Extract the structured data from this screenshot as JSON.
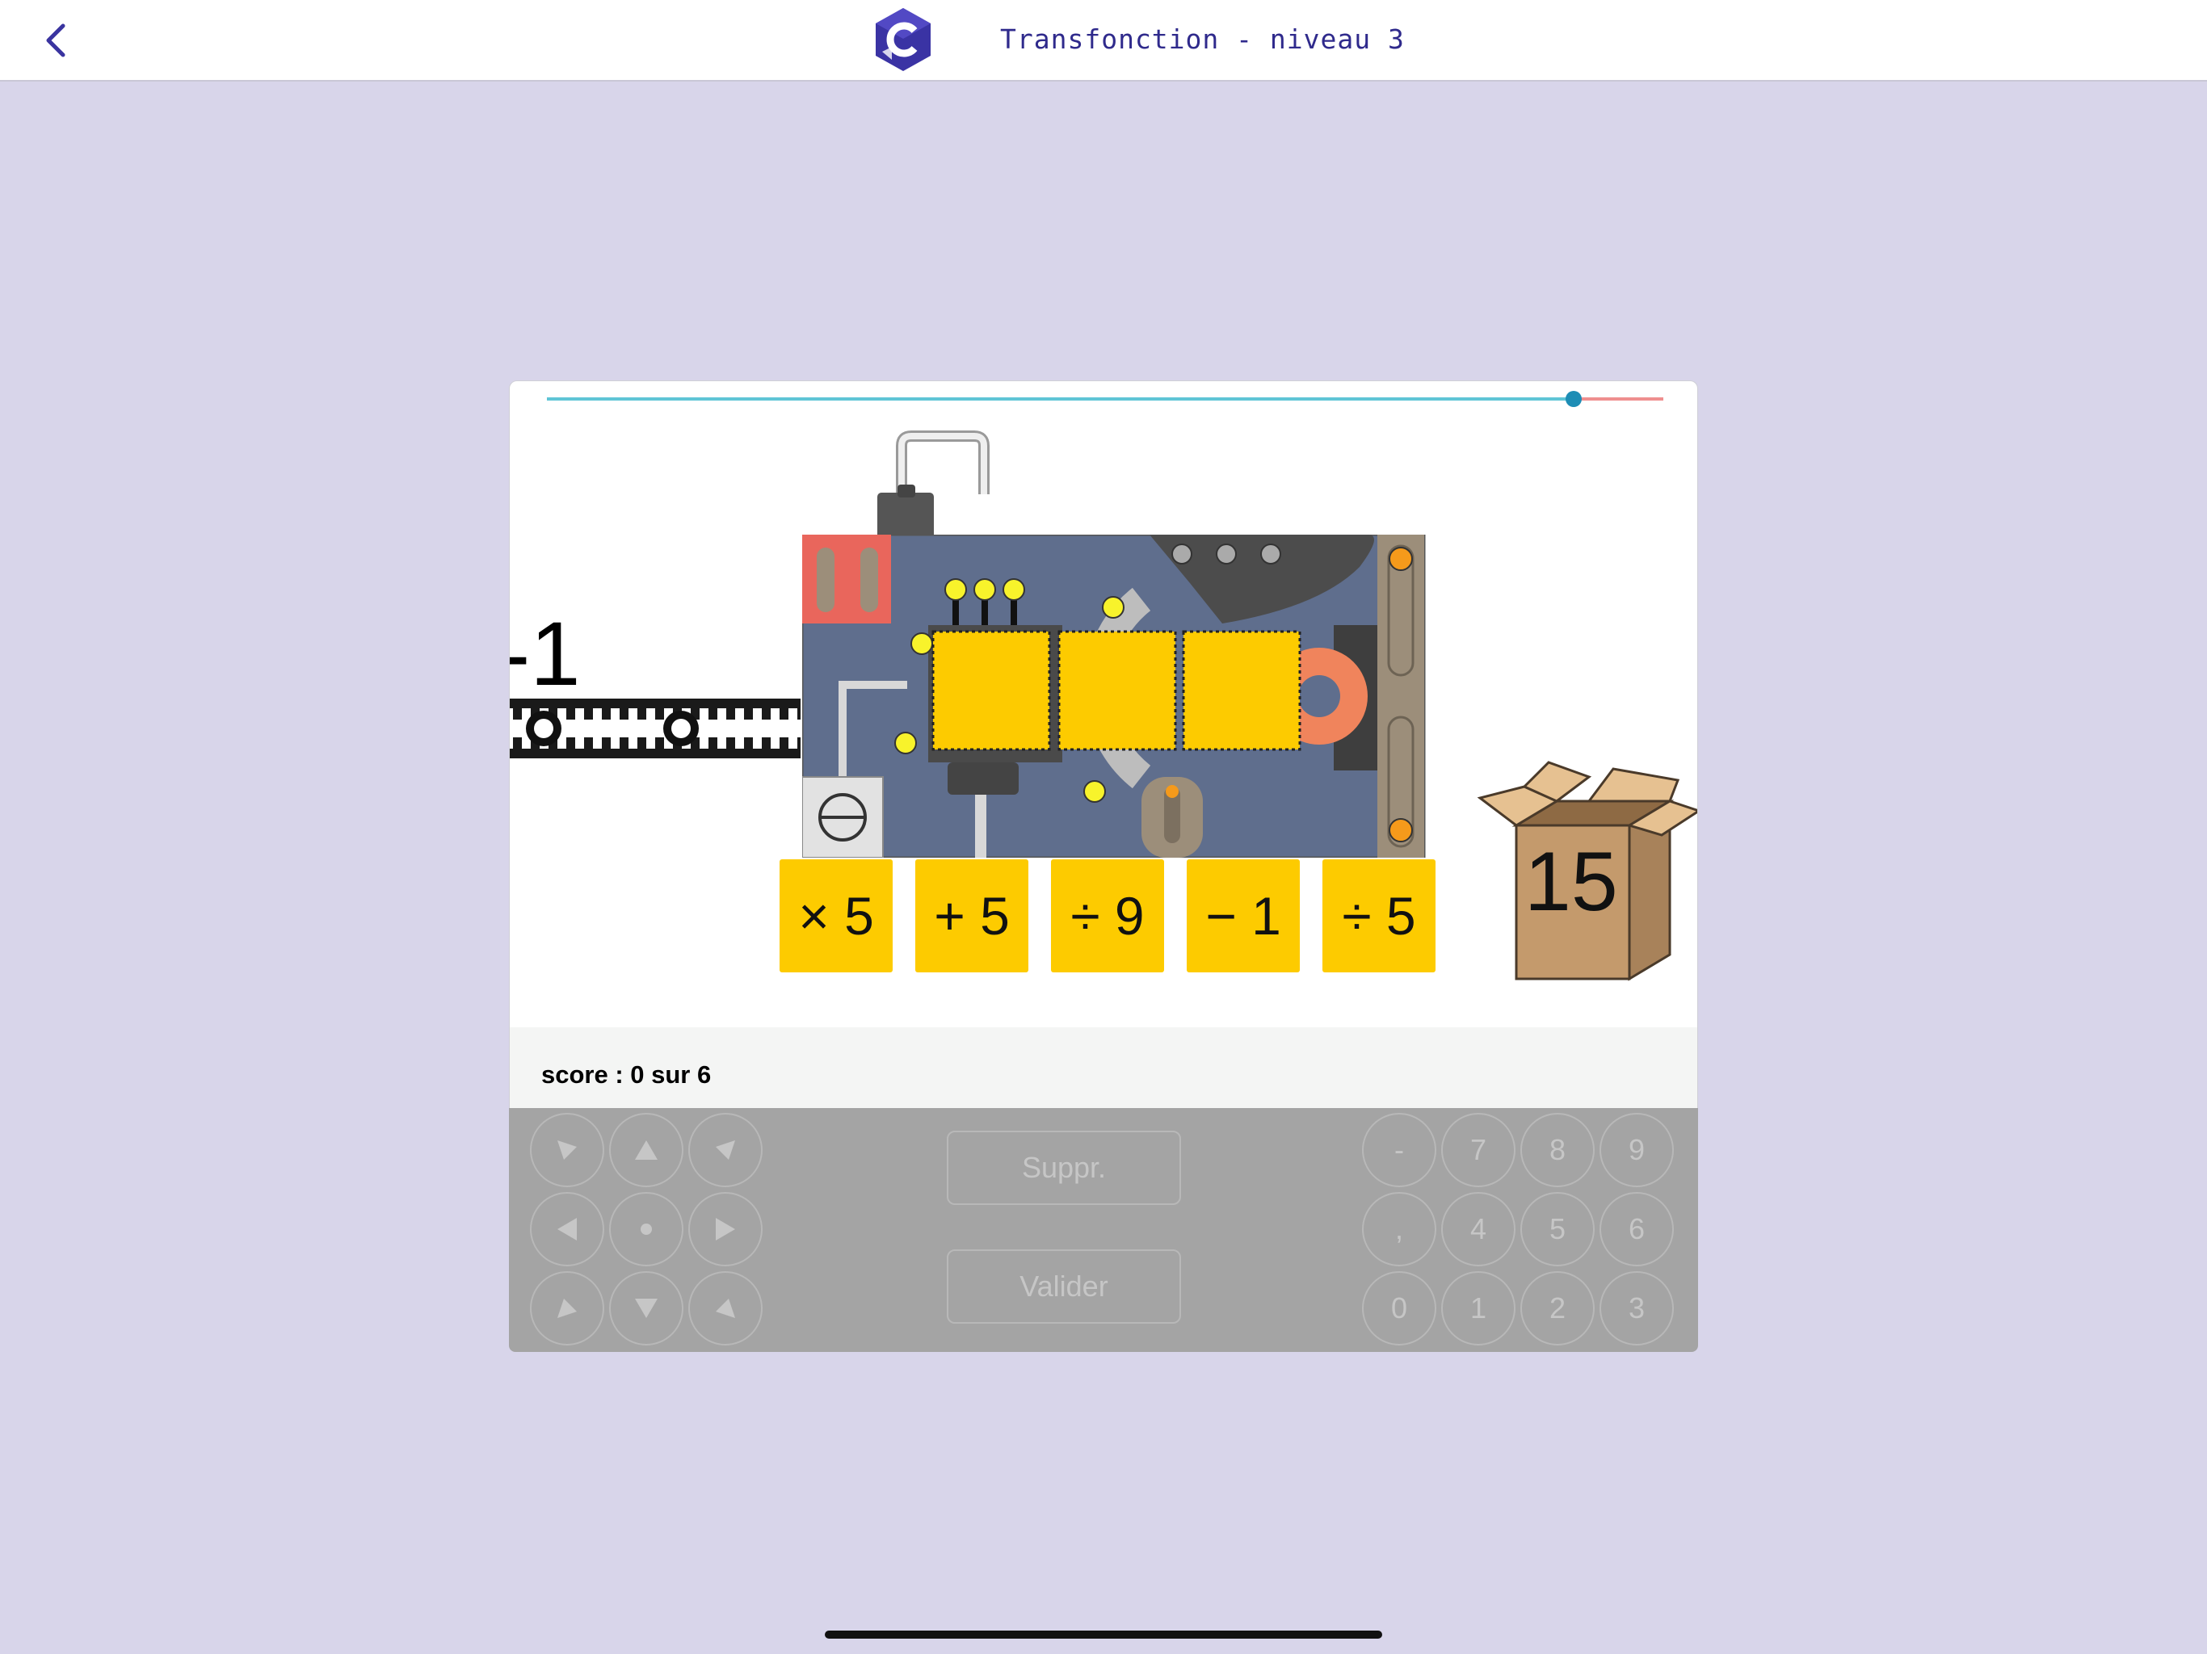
{
  "header": {
    "title": "Transfonction - niveau 3",
    "back_icon": "chevron-left-icon",
    "logo_icon": "hexagon-c-logo"
  },
  "game": {
    "progress_fraction": 0.92,
    "input_value": "-1",
    "output_value": "15",
    "machine_slots": 3,
    "operations": [
      "× 5",
      "+ 5",
      "÷ 9",
      "− 1",
      "÷ 5"
    ],
    "score_text": "score : 0 sur 6"
  },
  "keypad": {
    "arrows": [
      {
        "name": "arrow-up-left-key",
        "icon": "arrow-up-left-icon"
      },
      {
        "name": "arrow-up-key",
        "icon": "arrow-up-icon"
      },
      {
        "name": "arrow-up-right-key",
        "icon": "arrow-up-right-icon"
      },
      {
        "name": "arrow-left-key",
        "icon": "arrow-left-icon"
      },
      {
        "name": "center-key",
        "icon": "dot-icon"
      },
      {
        "name": "arrow-right-key",
        "icon": "arrow-right-icon"
      },
      {
        "name": "arrow-down-left-key",
        "icon": "arrow-down-left-icon"
      },
      {
        "name": "arrow-down-key",
        "icon": "arrow-down-icon"
      },
      {
        "name": "arrow-down-right-key",
        "icon": "arrow-down-right-icon"
      }
    ],
    "delete_label": "Suppr.",
    "validate_label": "Valider",
    "digits": [
      "-",
      "7",
      "8",
      "9",
      ",",
      "4",
      "5",
      "6",
      "0",
      "1",
      "2",
      "3"
    ]
  },
  "colors": {
    "background": "#d8d5ea",
    "title": "#2f2a8c",
    "tile": "#fdcb00",
    "machine": "#5f6e8d",
    "keypad": "#a4a4a4"
  }
}
